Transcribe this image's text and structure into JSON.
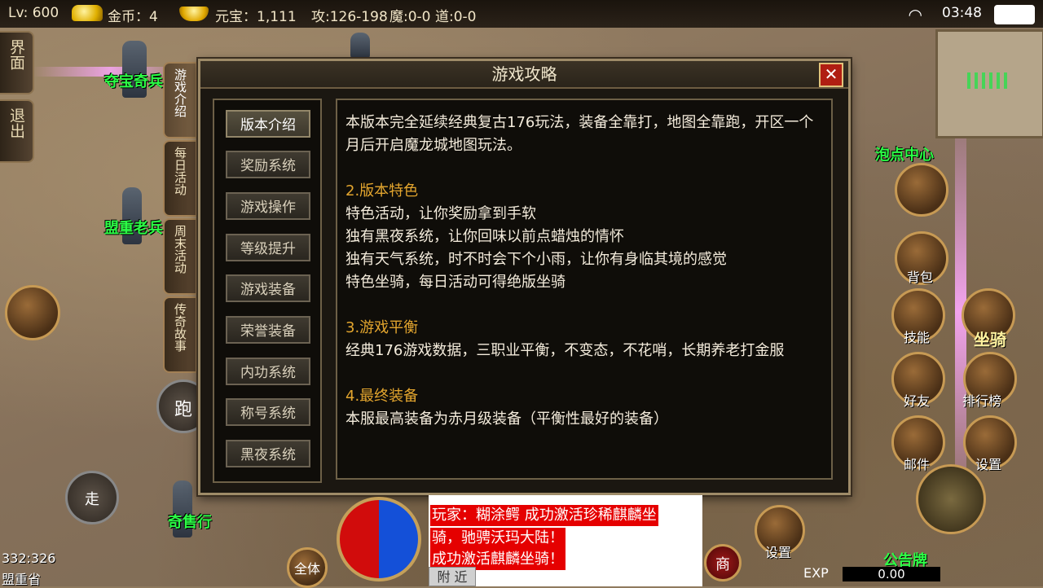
{
  "status_bar": {
    "level": "Lv: 600",
    "gold_label": "金币：4",
    "yuanbao_label": "元宝：1,111",
    "attack": "攻:126-198",
    "magic": "魔:0-0",
    "tao": "道:0-0",
    "time": "03:48"
  },
  "left_buttons": [
    "界面",
    "退出"
  ],
  "side_tabs": [
    "游戏介绍",
    "每日活动",
    "周末活动",
    "传奇故事"
  ],
  "npcs": [
    "夺宝奇兵",
    "盟重老兵",
    "奇售行",
    "泡点中心"
  ],
  "movement": {
    "run": "跑",
    "walk": "走"
  },
  "dialog": {
    "title": "游戏攻略",
    "close": "✕",
    "menu": [
      "版本介绍",
      "奖励系统",
      "游戏操作",
      "等级提升",
      "游戏装备",
      "荣誉装备",
      "内功系统",
      "称号系统",
      "黑夜系统"
    ],
    "content": {
      "intro": "本版本完全延续经典复古176玩法，装备全靠打，地图全靠跑，开区一个月后开启魔龙城地图玩法。",
      "h2": "2.版本特色",
      "s2": [
        "特色活动，让你奖励拿到手软",
        "独有黑夜系统，让你回味以前点蜡烛的情怀",
        "独有天气系统，时不时会下个小雨，让你有身临其境的感觉",
        "特色坐骑，每日活动可得绝版坐骑"
      ],
      "h3": "3.游戏平衡",
      "s3": "经典176游戏数据，三职业平衡，不变态，不花哨，长期养老打金服",
      "h4": "4.最终装备",
      "s4": "本服最高装备为赤月级装备（平衡性最好的装备）"
    }
  },
  "right_buttons": [
    "背包",
    "技能",
    "坐骑",
    "好友",
    "排行榜",
    "邮件",
    "设置",
    "设置",
    "公告牌"
  ],
  "chat": {
    "lines": [
      "玩家：糊涂鳄  成功激活珍稀麒麟坐",
      "骑，驰骋沃玛大陆！",
      "成功激活麒麟坐骑！"
    ],
    "tab": "附 近"
  },
  "bottom": {
    "all_label": "全体",
    "shop": "商",
    "exp_label": "EXP",
    "exp_value": "0.00"
  },
  "location": {
    "coords": "332:326",
    "map": "盟重省"
  }
}
